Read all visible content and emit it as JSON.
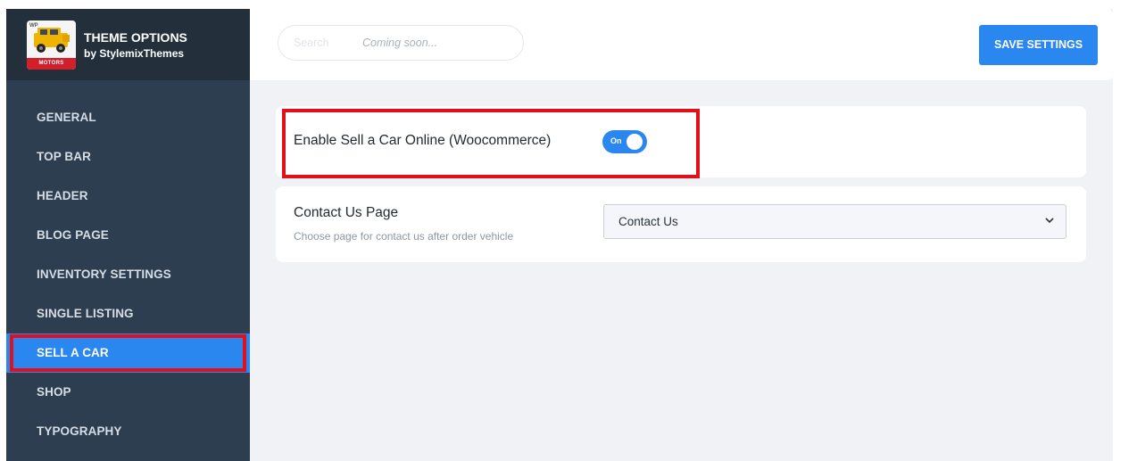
{
  "brand": {
    "title": "THEME OPTIONS",
    "subtitle": "by StylemixThemes",
    "logo_badge": "MOTORS",
    "logo_corner": "WP"
  },
  "sidebar": {
    "items": [
      {
        "label": "GENERAL",
        "active": false
      },
      {
        "label": "TOP BAR",
        "active": false
      },
      {
        "label": "HEADER",
        "active": false
      },
      {
        "label": "BLOG PAGE",
        "active": false
      },
      {
        "label": "INVENTORY SETTINGS",
        "active": false
      },
      {
        "label": "SINGLE LISTING",
        "active": false
      },
      {
        "label": "SELL A CAR",
        "active": true
      },
      {
        "label": "SHOP",
        "active": false
      },
      {
        "label": "TYPOGRAPHY",
        "active": false
      }
    ]
  },
  "topbar": {
    "search_placeholder": "Search",
    "search_hint": "Coming soon...",
    "save_label": "SAVE SETTINGS"
  },
  "settings": {
    "sell_online": {
      "label": "Enable Sell a Car Online (Woocommerce)",
      "toggle_text": "On",
      "enabled": true
    },
    "contact_page": {
      "title": "Contact Us Page",
      "description": "Choose page for contact us after order vehicle",
      "selected": "Contact Us"
    }
  },
  "colors": {
    "accent": "#2b87f0",
    "sidebar_bg": "#2d3e50",
    "highlight": "#e3101a"
  }
}
